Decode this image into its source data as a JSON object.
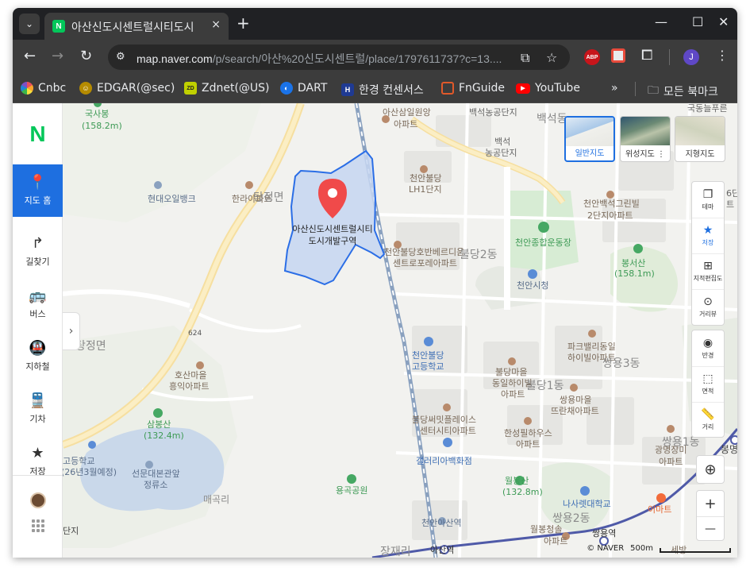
{
  "browser": {
    "tab_search_icon": "chevron-down-icon",
    "tab_title": "아산신도시센트럴시티도시",
    "tab_close": "×",
    "new_tab": "+",
    "window_controls": {
      "minimize": "—",
      "maximize": "☐",
      "close": "✕"
    },
    "url_host": "map.naver.com",
    "url_path": "/p/search/아산%20신도시센트럴/place/1797611737?c=13....",
    "profile_initial": "J",
    "abp_label": "ABP"
  },
  "bookmarks": [
    {
      "label": "Cnbc",
      "icon": "cnbc-peacock-icon",
      "color": "#e8505b"
    },
    {
      "label": "EDGAR(@sec)",
      "icon": "sec-seal-icon",
      "color": "#b58b00"
    },
    {
      "label": "Zdnet(@US)",
      "icon": "zdnet-icon",
      "color": "#c0d000"
    },
    {
      "label": "DART",
      "icon": "dart-icon",
      "color": "#1a73e8"
    },
    {
      "label": "한경 컨센서스",
      "icon": "hankyung-icon",
      "color": "#1f3a93"
    },
    {
      "label": "FnGuide",
      "icon": "fnguide-icon",
      "color": "#e0592a"
    },
    {
      "label": "YouTube",
      "icon": "youtube-icon",
      "color": "#ff0000"
    }
  ],
  "bookmarks_overflow": "»",
  "bookmarks_folder": "모든 북마크",
  "sidebar": {
    "logo": "N",
    "items": [
      {
        "label": "지도 홈",
        "icon": "map-pin-icon",
        "active": true
      },
      {
        "label": "길찾기",
        "icon": "directions-arrow-icon",
        "active": false
      },
      {
        "label": "버스",
        "icon": "bus-icon",
        "active": false
      },
      {
        "label": "지하철",
        "icon": "subway-icon",
        "active": false
      },
      {
        "label": "기차",
        "icon": "train-icon",
        "active": false
      },
      {
        "label": "저장",
        "icon": "star-icon",
        "active": false
      }
    ],
    "collapse_icon": "›"
  },
  "map": {
    "place_label_line1": "아산신도시센트럴시티",
    "place_label_line2": "도시개발구역",
    "map_types": [
      {
        "label": "일반지도",
        "active": true
      },
      {
        "label": "위성지도 ⋮",
        "active": false
      },
      {
        "label": "지형지도",
        "active": false
      }
    ],
    "tools": [
      {
        "label": "테마",
        "icon": "layers-icon"
      },
      {
        "label": "저장",
        "icon": "star-icon",
        "active": true
      },
      {
        "label": "지적편집도",
        "icon": "cadastral-icon"
      },
      {
        "label": "거리뷰",
        "icon": "street-view-icon"
      },
      {
        "label": "반경",
        "icon": "radius-icon"
      },
      {
        "label": "면적",
        "icon": "area-icon"
      },
      {
        "label": "거리",
        "icon": "ruler-icon"
      }
    ],
    "zoom_in": "+",
    "zoom_out": "—",
    "attribution": "© NAVER",
    "scale": "500m",
    "labels": [
      {
        "text": "국사봉"
      },
      {
        "text": "(158.2m)"
      },
      {
        "text": "아산삼일원앙"
      },
      {
        "text": "아파트"
      },
      {
        "text": "백석농공단지"
      },
      {
        "text": "백석동"
      },
      {
        "text": "백석"
      },
      {
        "text": "농공단지"
      },
      {
        "text": "국동늘푸른"
      },
      {
        "text": "현대오일뱅크"
      },
      {
        "text": "한라아파트"
      },
      {
        "text": "탕정면"
      },
      {
        "text": "천안불당"
      },
      {
        "text": "LH1단지"
      },
      {
        "text": "천안백석그린빌"
      },
      {
        "text": "2단지아파트"
      },
      {
        "text": "6단"
      },
      {
        "text": "트"
      },
      {
        "text": "천안종합운동장"
      },
      {
        "text": "천안불당호반베르디움"
      },
      {
        "text": "센트로포레아파트"
      },
      {
        "text": "불당2동"
      },
      {
        "text": "봉서산"
      },
      {
        "text": "(158.1m)"
      },
      {
        "text": "천안시청"
      },
      {
        "text": "624"
      },
      {
        "text": "탕정면"
      },
      {
        "text": "천안불당"
      },
      {
        "text": "고등학교"
      },
      {
        "text": "파크밸리동일"
      },
      {
        "text": "하이빌아파트"
      },
      {
        "text": "쌍용3동"
      },
      {
        "text": "호산마을"
      },
      {
        "text": "흥익아파트"
      },
      {
        "text": "불당마을"
      },
      {
        "text": "동일하이빌"
      },
      {
        "text": "아파트"
      },
      {
        "text": "불당1동"
      },
      {
        "text": "쌍용마을"
      },
      {
        "text": "뜨란채아파트"
      },
      {
        "text": "삼봉산"
      },
      {
        "text": "(132.4m)"
      },
      {
        "text": "불당써밋플레이스"
      },
      {
        "text": "센터시티아파트"
      },
      {
        "text": "한성필하우스"
      },
      {
        "text": "아파트"
      },
      {
        "text": "쌍용1동"
      },
      {
        "text": "광명장미"
      },
      {
        "text": "아파트"
      },
      {
        "text": "봉명"
      },
      {
        "text": "고등학교"
      },
      {
        "text": "(26년3월예정)"
      },
      {
        "text": "갤러리아백화점"
      },
      {
        "text": "선문대본관앞"
      },
      {
        "text": "정류소"
      },
      {
        "text": "용곡공원"
      },
      {
        "text": "월봉산"
      },
      {
        "text": "(132.8m)"
      },
      {
        "text": "매곡리"
      },
      {
        "text": "나사렛대학교"
      },
      {
        "text": "이마트"
      },
      {
        "text": "천안아산역"
      },
      {
        "text": "쌍용2동"
      },
      {
        "text": "쌍용역"
      },
      {
        "text": "월봉청솔"
      },
      {
        "text": "아파트"
      },
      {
        "text": "아산역"
      },
      {
        "text": "장재리"
      },
      {
        "text": "단지"
      },
      {
        "text": "세방"
      }
    ]
  }
}
